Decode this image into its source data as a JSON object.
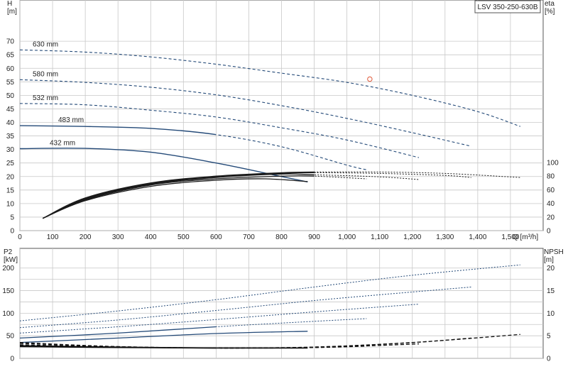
{
  "chart_data": [
    {
      "type": "line",
      "title": "LSV 350-250-630B",
      "xlabel": "Q [m³/h]",
      "ylabel": "H\n[m]",
      "y2label": "eta\n[%]",
      "xlim": [
        0,
        1600
      ],
      "ylim": [
        0,
        80
      ],
      "y2lim": [
        0,
        100
      ],
      "xticks": [
        "0",
        "100",
        "200",
        "300",
        "400",
        "500",
        "600",
        "700",
        "800",
        "900",
        "1,000",
        "1,100",
        "1,200",
        "1,300",
        "1,400",
        "1,500"
      ],
      "yticks": [
        "0",
        "5",
        "10",
        "15",
        "20",
        "25",
        "30",
        "35",
        "40",
        "45",
        "50",
        "55",
        "60",
        "65",
        "70"
      ],
      "y2ticks": [
        "0",
        "20",
        "40",
        "60",
        "80",
        "100"
      ],
      "grid": true,
      "series": [
        {
          "name": "630 mm",
          "x": [
            0,
            200,
            400,
            600,
            800,
            1000,
            1200,
            1400,
            1530
          ],
          "y": [
            66.8,
            66.0,
            64.2,
            61.5,
            58.2,
            54.8,
            50.0,
            44.0,
            38.5
          ],
          "solid_until": 0
        },
        {
          "name": "580 mm",
          "x": [
            0,
            200,
            400,
            600,
            800,
            1000,
            1200,
            1380
          ],
          "y": [
            55.8,
            54.8,
            53.0,
            50.2,
            46.2,
            41.5,
            36.2,
            31.2
          ],
          "solid_until": 0
        },
        {
          "name": "532 mm",
          "x": [
            0,
            200,
            400,
            600,
            800,
            1000,
            1220
          ],
          "y": [
            47.0,
            46.5,
            44.5,
            42.0,
            38.0,
            33.5,
            27.0
          ],
          "solid_until": 0
        },
        {
          "name": "483 mm",
          "x": [
            0,
            200,
            400,
            600,
            800,
            1000,
            1060
          ],
          "y": [
            38.8,
            38.5,
            37.8,
            35.5,
            31.0,
            24.2,
            22.5
          ],
          "solid_until": 600
        },
        {
          "name": "432 mm",
          "x": [
            0,
            200,
            400,
            600,
            800,
            880
          ],
          "y": [
            30.3,
            30.4,
            29.0,
            25.0,
            20.0,
            18.0
          ],
          "solid_until": 880
        }
      ],
      "efficiency_series": [
        {
          "x": [
            70,
            200,
            400,
            600,
            800,
            900,
            1100,
            1300,
            1530
          ],
          "y": [
            18,
            48,
            70,
            80,
            85,
            86,
            86,
            84,
            78
          ]
        },
        {
          "x": [
            70,
            200,
            400,
            600,
            800,
            900,
            1100,
            1300,
            1380
          ],
          "y": [
            18,
            47,
            69,
            79,
            84,
            85,
            84,
            81,
            78
          ]
        },
        {
          "x": [
            70,
            200,
            400,
            600,
            800,
            900,
            1100,
            1220
          ],
          "y": [
            18,
            46,
            68,
            78,
            83,
            82,
            79,
            75
          ]
        },
        {
          "x": [
            70,
            200,
            400,
            600,
            800,
            900,
            1060
          ],
          "y": [
            18,
            45,
            67,
            76,
            80,
            80,
            76
          ]
        },
        {
          "x": [
            70,
            200,
            400,
            600,
            750,
            880
          ],
          "y": [
            18,
            44,
            65,
            74,
            76,
            72
          ]
        }
      ],
      "marker": {
        "x": 1070,
        "y": 56
      }
    },
    {
      "type": "line",
      "ylabel": "P2\n[kW]",
      "y2label": "NPSH\n[m]",
      "xlim": [
        0,
        1600
      ],
      "ylim": [
        0,
        220
      ],
      "y2lim": [
        0,
        22
      ],
      "yticks": [
        "0",
        "50",
        "100",
        "150",
        "200"
      ],
      "y2ticks": [
        "0",
        "5",
        "10",
        "15",
        "20"
      ],
      "grid": true,
      "power_series": [
        {
          "x": [
            0,
            300,
            600,
            900,
            1200,
            1530
          ],
          "y": [
            83,
            105,
            130,
            158,
            184,
            207
          ],
          "solid_until": 0
        },
        {
          "x": [
            0,
            300,
            600,
            900,
            1200,
            1380
          ],
          "y": [
            68,
            85,
            106,
            128,
            147,
            158
          ],
          "solid_until": 0
        },
        {
          "x": [
            0,
            300,
            600,
            900,
            1220
          ],
          "y": [
            56,
            70,
            86,
            103,
            120
          ],
          "solid_until": 0
        },
        {
          "x": [
            0,
            300,
            600,
            900,
            1060
          ],
          "y": [
            45,
            56,
            70,
            82,
            88
          ],
          "solid_until": 600
        },
        {
          "x": [
            0,
            300,
            600,
            880
          ],
          "y": [
            35,
            45,
            55,
            60
          ],
          "solid_until": 880
        }
      ],
      "npsh_series": [
        {
          "x": [
            0,
            300,
            600,
            900,
            1200,
            1530
          ],
          "y": [
            3.5,
            2.6,
            2.3,
            2.5,
            3.5,
            5.3
          ],
          "solid_until": 0
        },
        {
          "x": [
            0,
            300,
            600,
            900,
            1200,
            1380
          ],
          "y": [
            3.3,
            2.6,
            2.3,
            2.5,
            3.5,
            4.5
          ],
          "solid_until": 0
        },
        {
          "x": [
            0,
            300,
            600,
            900,
            1220
          ],
          "y": [
            3.0,
            2.5,
            2.3,
            2.4,
            3.2
          ],
          "solid_until": 0
        },
        {
          "x": [
            0,
            300,
            600,
            900,
            1060
          ],
          "y": [
            2.8,
            2.5,
            2.3,
            2.4,
            2.7
          ],
          "solid_until": 600
        },
        {
          "x": [
            0,
            300,
            600,
            880
          ],
          "y": [
            2.6,
            2.4,
            2.3,
            2.3
          ],
          "solid_until": 880
        }
      ]
    }
  ]
}
